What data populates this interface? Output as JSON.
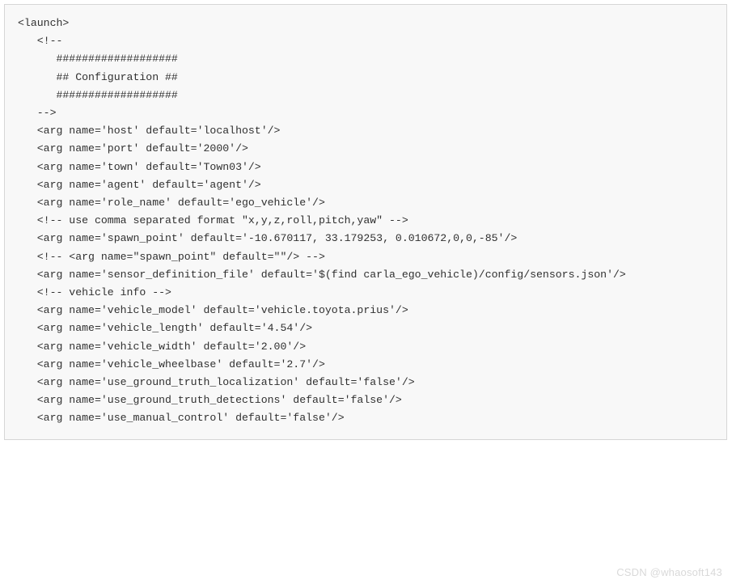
{
  "code": {
    "lines": [
      "<launch>",
      "   <!--",
      "      ###################",
      "      ## Configuration ##",
      "      ###################",
      "   -->",
      "   <arg name='host' default='localhost'/>",
      "   <arg name='port' default='2000'/>",
      "   <arg name='town' default='Town03'/>",
      "",
      "   <arg name='agent' default='agent'/>",
      "",
      "   <arg name='role_name' default='ego_vehicle'/>",
      "   <!-- use comma separated format \"x,y,z,roll,pitch,yaw\" -->",
      "   <arg name='spawn_point' default='-10.670117, 33.179253, 0.010672,0,0,-85'/>",
      "   <!-- <arg name=\"spawn_point\" default=\"\"/> -->",
      "",
      "   <arg name='sensor_definition_file' default='$(find carla_ego_vehicle)/config/sensors.json'/>",
      "",
      "   <!-- vehicle info -->",
      "   <arg name='vehicle_model' default='vehicle.toyota.prius'/>",
      "   <arg name='vehicle_length' default='4.54'/>",
      "   <arg name='vehicle_width' default='2.00'/>",
      "   <arg name='vehicle_wheelbase' default='2.7'/>",
      "",
      "   <arg name='use_ground_truth_localization' default='false'/>",
      "   <arg name='use_ground_truth_detections' default='false'/>",
      "   <arg name='use_manual_control' default='false'/>"
    ]
  },
  "watermark": "CSDN @whaosoft143"
}
